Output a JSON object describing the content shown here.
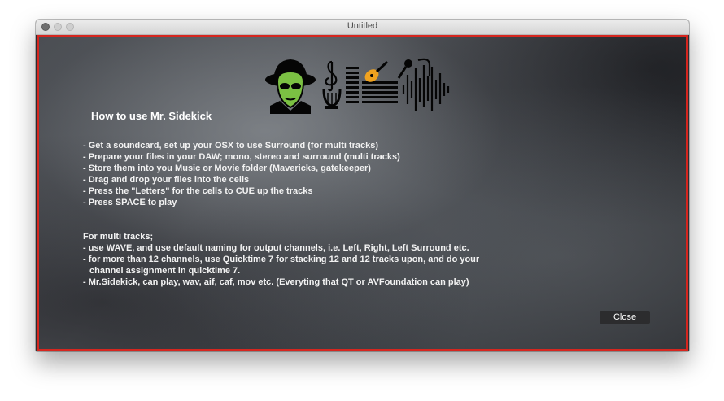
{
  "window": {
    "title": "Untitled"
  },
  "logo": {
    "icons": [
      "spy-face-icon",
      "treble-clef-icon",
      "lyre-icon",
      "mixer-icon",
      "guitar-icon",
      "microphone-icon",
      "waveform-icon"
    ],
    "accent_color": "#7bc043",
    "guitar_color": "#f0a21f"
  },
  "help": {
    "title": "How to use Mr. Sidekick",
    "steps": [
      "- Get a soundcard, set up your OSX to use Surround (for multi tracks)",
      "- Prepare your files in your DAW; mono, stereo and surround (multi tracks)",
      "- Store them into you Music or Movie folder (Mavericks, gatekeeper)",
      "- Drag and drop your files into the cells",
      "- Press the \"Letters\" for the cells to CUE up the tracks",
      "- Press SPACE to play"
    ],
    "multi_title": "For multi tracks;",
    "multi_lines": [
      "- use WAVE, and use default naming for output channels, i.e. Left, Right, Left Surround etc.",
      "- for more than 12 channels, use Quicktime 7 for stacking 12 and 12 tracks upon, and do your",
      "channel assignment in quicktime 7.",
      "- Mr.Sidekick, can play, wav, aif, caf, mov etc. (Everyting that QT or AVFoundation can play)"
    ]
  },
  "close_label": "Close",
  "colors": {
    "border": "#d6261f",
    "text": "#ffffff"
  }
}
